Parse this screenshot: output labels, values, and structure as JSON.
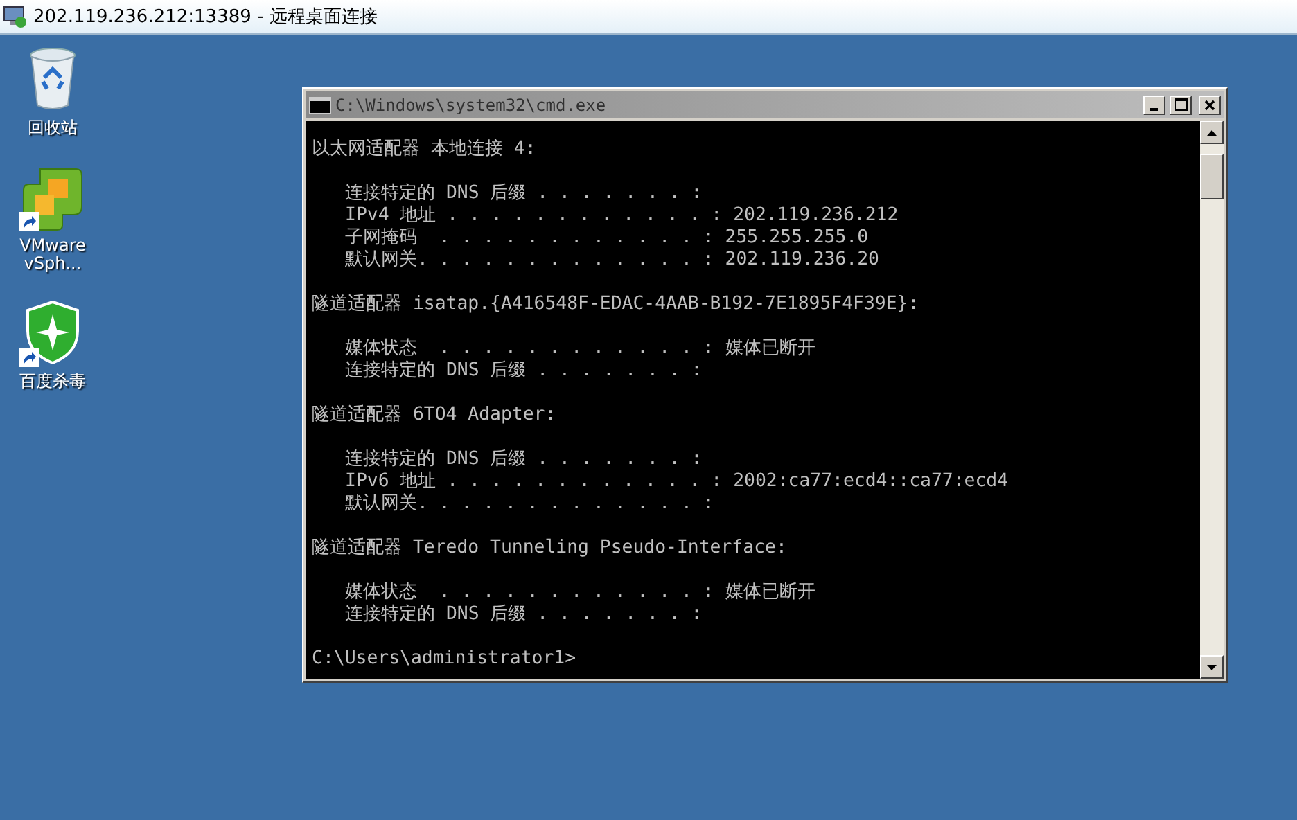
{
  "window": {
    "title": "202.119.236.212:13389 - 远程桌面连接"
  },
  "desktop_icons": [
    {
      "kind": "recycle-bin",
      "label": "回收站",
      "shortcut": false
    },
    {
      "kind": "vsphere",
      "label": "VMware vSph...",
      "shortcut": true
    },
    {
      "kind": "shield",
      "label": "百度杀毒",
      "shortcut": true
    }
  ],
  "console": {
    "title": "C:\\Windows\\system32\\cmd.exe",
    "blocks": [
      [
        {
          "text": "以太网适配器 本地连接 4:",
          "indent": false
        }
      ],
      [
        {
          "text": "连接特定的 DNS 后缀 . . . . . . . :",
          "indent": true
        },
        {
          "text": "IPv4 地址 . . . . . . . . . . . . : 202.119.236.212",
          "indent": true
        },
        {
          "text": "子网掩码  . . . . . . . . . . . . : 255.255.255.0",
          "indent": true
        },
        {
          "text": "默认网关. . . . . . . . . . . . . : 202.119.236.20",
          "indent": true
        }
      ],
      [
        {
          "text": "隧道适配器 isatap.{A416548F-EDAC-4AAB-B192-7E1895F4F39E}:",
          "indent": false
        }
      ],
      [
        {
          "text": "媒体状态  . . . . . . . . . . . . : 媒体已断开",
          "indent": true
        },
        {
          "text": "连接特定的 DNS 后缀 . . . . . . . :",
          "indent": true
        }
      ],
      [
        {
          "text": "隧道适配器 6TO4 Adapter:",
          "indent": false
        }
      ],
      [
        {
          "text": "连接特定的 DNS 后缀 . . . . . . . :",
          "indent": true
        },
        {
          "text": "IPv6 地址 . . . . . . . . . . . . : 2002:ca77:ecd4::ca77:ecd4",
          "indent": true
        },
        {
          "text": "默认网关. . . . . . . . . . . . . :",
          "indent": true
        }
      ],
      [
        {
          "text": "隧道适配器 Teredo Tunneling Pseudo-Interface:",
          "indent": false
        }
      ],
      [
        {
          "text": "媒体状态  . . . . . . . . . . . . : 媒体已断开",
          "indent": true
        },
        {
          "text": "连接特定的 DNS 后缀 . . . . . . . :",
          "indent": true
        }
      ],
      [
        {
          "text": "C:\\Users\\administrator1>",
          "indent": false
        }
      ]
    ]
  }
}
